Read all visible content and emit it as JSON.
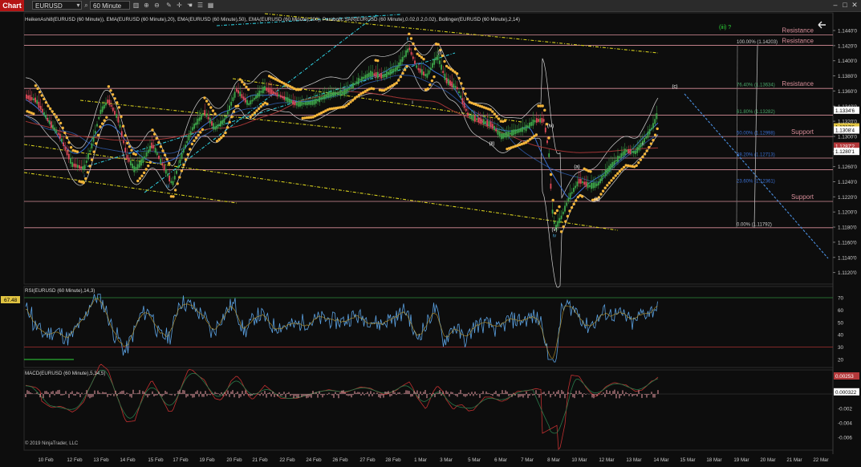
{
  "toolbar": {
    "chart_tab": "Chart",
    "instrument": "EURUSD",
    "interval": "60 Minute"
  },
  "price_panel": {
    "indicators": "HeikenAshi8(EURUSD (60 Minute)), EMA(EURUSD (60 Minute),20), EMA(EURUSD (60 Minute),50), EMA(EURUSD (60 Minute),200), Parabolic SAR(EURUSD (60 Minute),0.02,0.2,0.02), Bollinger(EURUSD (60 Minute),2,14)",
    "wave_label": "(iii) ?",
    "levels": [
      {
        "price": 1.1434,
        "text": "Resistance",
        "color": "#d98f9a"
      },
      {
        "price": 1.14203,
        "text": "Resistance",
        "color": "#d98f9a"
      },
      {
        "price": 1.13634,
        "text": "Resistance",
        "color": "#d98f9a"
      },
      {
        "price": 1.1328,
        "text": "",
        "color": "#d98f9a"
      },
      {
        "price": 1.12998,
        "text": "Support",
        "color": "#d98f9a"
      },
      {
        "price": 1.12713,
        "text": "",
        "color": "#d98f9a"
      },
      {
        "price": 1.1256,
        "text": "",
        "color": "#d98f9a"
      },
      {
        "price": 1.1214,
        "text": "Support",
        "color": "#d98f9a"
      },
      {
        "price": 1.11792,
        "text": "",
        "color": "#d98f9a"
      }
    ],
    "fib_levels": [
      {
        "price": 1.14203,
        "text": "100.00% (1.14203)",
        "color": "#cccccc"
      },
      {
        "price": 1.13634,
        "text": "76.40% (1.13634)",
        "color": "#4aa86a"
      },
      {
        "price": 1.13282,
        "text": "61.80% (1.13282)",
        "color": "#4aa86a"
      },
      {
        "price": 1.12998,
        "text": "50.00% (1.12998)",
        "color": "#3a6fd0"
      },
      {
        "price": 1.12713,
        "text": "38.20% (1.12713)",
        "color": "#3a6fd0"
      },
      {
        "price": 1.12361,
        "text": "23.60% (1.12361)",
        "color": "#3a6fd0"
      },
      {
        "price": 1.11792,
        "text": "0.00% (1.11792)",
        "color": "#cccccc"
      }
    ],
    "y_ticks": [
      "1.1440'0",
      "1.1420'0",
      "1.1400'0",
      "1.1380'0",
      "1.1360'0",
      "1.1340'0",
      "1.1320'0",
      "1.1300'0",
      "1.1280'0",
      "1.1260'0",
      "1.1240'0",
      "1.1220'0",
      "1.1200'0",
      "1.1180'0",
      "1.1160'0",
      "1.1140'0",
      "1.1120'0"
    ],
    "price_tags": [
      {
        "text": "1.1334'6",
        "bg": "#ffffff",
        "fg": "#000000",
        "price": 1.13346
      },
      {
        "text": "1.1312'6",
        "bg": "#e0c341",
        "fg": "#000000",
        "price": 1.13126
      },
      {
        "text": "1.1308'4",
        "bg": "#ffffff",
        "fg": "#000000",
        "price": 1.13084
      },
      {
        "text": "1.1287'2",
        "bg": "#b4383a",
        "fg": "#ffffff",
        "price": 1.12872
      },
      {
        "text": "1.1280'1",
        "bg": "#ffffff",
        "fg": "#000000",
        "price": 1.12801
      }
    ],
    "annotations": [
      {
        "text": "ii",
        "x": 508,
        "price": 1.1427,
        "color": "#4aa8d8"
      },
      {
        "text": "(i)",
        "x": 548,
        "price": 1.1409,
        "color": "#ffffff"
      },
      {
        "text": "i",
        "x": 105,
        "price": 1.1246,
        "color": "#4aa8d8"
      },
      {
        "text": "i",
        "x": 514,
        "price": 1.1343,
        "color": "#ffffff"
      },
      {
        "text": "iii",
        "x": 209,
        "price": 1.1232,
        "color": "#4aa8d8"
      },
      {
        "text": "(ii)",
        "x": 613,
        "price": 1.1289,
        "color": "#ffffff"
      },
      {
        "text": "(iv)",
        "x": 686,
        "price": 1.1312,
        "color": "#ffffff"
      },
      {
        "text": "(a)",
        "x": 719,
        "price": 1.1258,
        "color": "#ffffff"
      },
      {
        "text": "(b)",
        "x": 744,
        "price": 1.1215,
        "color": "#ffffff"
      },
      {
        "text": "(c)",
        "x": 841,
        "price": 1.1364,
        "color": "#ffffff"
      },
      {
        "text": "(v)",
        "x": 691,
        "price": 1.1175,
        "color": "#ffffff"
      },
      {
        "text": "iv",
        "x": 691,
        "price": 1.1167,
        "color": "#4aa8d8"
      },
      {
        "text": "i",
        "x": 801,
        "price": 1.1288,
        "color": "#ffffff"
      }
    ]
  },
  "rsi_panel": {
    "label": "RSI(EURUSD (60 Minute),14,3)",
    "value_tag": "67.48",
    "y_ticks": [
      {
        "v": 70,
        "t": "70"
      },
      {
        "v": 60,
        "t": "60"
      },
      {
        "v": 50,
        "t": "50"
      },
      {
        "v": 40,
        "t": "40"
      },
      {
        "v": 30,
        "t": "30"
      },
      {
        "v": 20,
        "t": "20"
      }
    ]
  },
  "macd_panel": {
    "label": "MACD(EURUSD (60 Minute),5,34,5)",
    "value_tags": [
      {
        "text": "0.00253",
        "bg": "#b4383a",
        "fg": "#ffffff",
        "value": 0.0025
      },
      {
        "text": "0.000322",
        "bg": "#ffffff",
        "fg": "#000000",
        "value": 0.0003
      }
    ],
    "y_ticks": [
      {
        "v": -0.002,
        "t": "-0.002"
      },
      {
        "v": -0.004,
        "t": "-0.004"
      },
      {
        "v": -0.006,
        "t": "-0.006"
      }
    ],
    "copyright": "© 2019 NinjaTrader, LLC"
  },
  "x_axis": {
    "labels": [
      "10 Feb",
      "12 Feb",
      "13 Feb",
      "14 Feb",
      "15 Feb",
      "17 Feb",
      "19 Feb",
      "20 Feb",
      "21 Feb",
      "22 Feb",
      "24 Feb",
      "26 Feb",
      "27 Feb",
      "28 Feb",
      "1 Mar",
      "3 Mar",
      "5 Mar",
      "6 Mar",
      "7 Mar",
      "8 Mar",
      "10 Mar",
      "12 Mar",
      "13 Mar",
      "14 Mar",
      "15 Mar",
      "18 Mar",
      "19 Mar",
      "20 Mar",
      "21 Mar",
      "22 Mar"
    ]
  },
  "colors": {
    "background": "#0d0d0d",
    "up_candle": "#3ea84a",
    "down_candle": "#e04a5a",
    "sar": "#f2b43a",
    "ema_blue": "#3a6fd0",
    "ema_red": "#a03535",
    "bollinger": "#d0d0d0",
    "trend_yellow": "#d6cf1e",
    "trend_cyan": "#2ec8d8",
    "rsi_line": "#5aa0e0",
    "macd_hist": "#f0a0a8",
    "macd_line": "#c03030",
    "signal_line": "#2a7a4a"
  },
  "icons": [
    "chevron-down-icon",
    "search-icon",
    "crosshair-icon",
    "pencil-icon",
    "hand-icon",
    "zoom-icon",
    "list-icon",
    "bars-icon",
    "back-arrow-icon"
  ]
}
